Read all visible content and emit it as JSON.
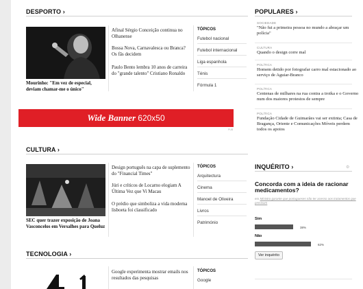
{
  "desporto": {
    "heading": "DESPORTO",
    "photo_caption": "Mourinho: \"Em vez de especial, deviam chamar-me o único\"",
    "stories": [
      "Afinal Sérgio Conceição continua no Olhanense",
      "Bossa Nova, Carnavalesca ou Branca? Os fãs decidem",
      "Paulo Bento lembra 10 anos de carreira do \"grande talento\" Cristiano Ronaldo"
    ],
    "topics_label": "TÓPICOS",
    "topics": [
      "Futebol nacional",
      "Futebol internacional",
      "Liga espanhola",
      "Ténis",
      "Fórmula 1"
    ]
  },
  "banner": {
    "bold_text": "Wide Banner",
    "size_text": "620x50",
    "tag": "PUB"
  },
  "cultura": {
    "heading": "CULTURA",
    "photo_caption": "SEC quer trazer exposição de Joana Vasconcelos em Versalhes para Queluz",
    "stories": [
      "Design português na capa de suplemento do \"Financial Times\"",
      "Júri e críticos de Locarno elogiam A Última Vez que Vi Macau",
      "O prédio que simboliza a vida moderna lisboeta foi classificado"
    ],
    "topics_label": "TÓPICOS",
    "topics": [
      "Arquitectura",
      "Cinema",
      "Manoel de Oliveira",
      "Livros",
      "Património"
    ]
  },
  "tecnologia": {
    "heading": "TECNOLOGIA",
    "stories": [
      "Google experimenta mostrar emails nos resultados das pesquisas"
    ],
    "topics_label": "TÓPICOS",
    "topics": [
      "Google"
    ]
  },
  "populares": {
    "heading": "POPULARES",
    "items": [
      {
        "category": "SOCIEDADE",
        "title": "\"Não fui a primeira pessoa no mundo a abraçar um polícia\""
      },
      {
        "category": "CULTURA",
        "title": "Quando o design corre mal"
      },
      {
        "category": "POLÍTICA",
        "title": "Homem detido por fotografar carro mal estacionado ao serviço de Aguiar-Branco"
      },
      {
        "category": "POLÍTICA",
        "title": "Centenas de milhares na rua contra a troika e o Governo num dos maiores protestos de sempre"
      },
      {
        "category": "POLÍTICA",
        "title": "Fundação Cidade de Guimarães vai ser extinta; Casa de Bragança, Oriente e Comunicações Móveis perdem todos os apoios"
      }
    ]
  },
  "inquerito": {
    "heading": "INQUÉRITO",
    "question": "Concorda com a ideia de racionar medicamentos?",
    "subtitle_prefix": "em",
    "subtitle_link": "Ministro garante que portugueses não ter acesso aos tratamentos que precisam",
    "options": [
      {
        "label": "Sim",
        "percent": 38,
        "percent_text": "38%"
      },
      {
        "label": "Não",
        "percent": 62,
        "percent_text": "62%"
      }
    ],
    "button_label": "Ver inquérito"
  },
  "colors": {
    "banner_red": "#e01f26",
    "poll_bar": "#555555"
  },
  "icons": {
    "chevron": "chevron-right-icon",
    "settings": "gear-icon"
  }
}
